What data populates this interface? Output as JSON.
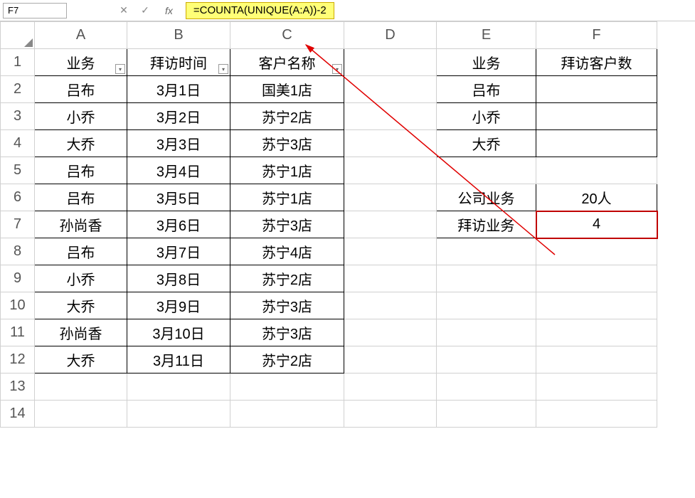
{
  "name_box": "F7",
  "formula": "=COUNTA(UNIQUE(A:A))-2",
  "columns": [
    "A",
    "B",
    "C",
    "D",
    "E",
    "F"
  ],
  "rows": [
    "1",
    "2",
    "3",
    "4",
    "5",
    "6",
    "7",
    "8",
    "9",
    "10",
    "11",
    "12",
    "13",
    "14"
  ],
  "headers": {
    "A": "业务",
    "B": "拜访时间",
    "C": "客户名称",
    "E": "业务",
    "F": "拜访客户数"
  },
  "table_main": [
    {
      "A": "吕布",
      "B": "3月1日",
      "C": "国美1店"
    },
    {
      "A": "小乔",
      "B": "3月2日",
      "C": "苏宁2店"
    },
    {
      "A": "大乔",
      "B": "3月3日",
      "C": "苏宁3店"
    },
    {
      "A": "吕布",
      "B": "3月4日",
      "C": "苏宁1店"
    },
    {
      "A": "吕布",
      "B": "3月5日",
      "C": "苏宁1店"
    },
    {
      "A": "孙尚香",
      "B": "3月6日",
      "C": "苏宁3店"
    },
    {
      "A": "吕布",
      "B": "3月7日",
      "C": "苏宁4店"
    },
    {
      "A": "小乔",
      "B": "3月8日",
      "C": "苏宁2店"
    },
    {
      "A": "大乔",
      "B": "3月9日",
      "C": "苏宁3店"
    },
    {
      "A": "孙尚香",
      "B": "3月10日",
      "C": "苏宁3店"
    },
    {
      "A": "大乔",
      "B": "3月11日",
      "C": "苏宁2店"
    }
  ],
  "col_e_names": [
    "吕布",
    "小乔",
    "大乔"
  ],
  "summary": {
    "e6": "公司业务",
    "f6": "20人",
    "e7": "拜访业务",
    "f7": "4"
  },
  "icons": {
    "dropdown": "▾",
    "cancel": "✕",
    "confirm": "✓",
    "fx": "fx"
  }
}
